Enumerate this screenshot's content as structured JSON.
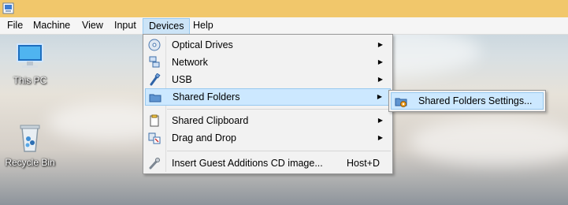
{
  "menubar": {
    "items": [
      {
        "label": "File"
      },
      {
        "label": "Machine"
      },
      {
        "label": "View"
      },
      {
        "label": "Input"
      },
      {
        "label": "Devices"
      },
      {
        "label": "Help"
      }
    ]
  },
  "desktop": {
    "icons": [
      {
        "label": "This PC",
        "icon": "computer-icon"
      },
      {
        "label": "Recycle Bin",
        "icon": "recycle-bin-icon"
      }
    ]
  },
  "devices_menu": {
    "items": [
      {
        "label": "Optical Drives",
        "icon": "optical-disc-icon",
        "submenu": true
      },
      {
        "label": "Network",
        "icon": "network-icon",
        "submenu": true
      },
      {
        "label": "USB",
        "icon": "usb-icon",
        "submenu": true
      },
      {
        "label": "Shared Folders",
        "icon": "folder-icon",
        "submenu": true,
        "highlighted": true
      },
      {
        "label": "Shared Clipboard",
        "icon": "clipboard-icon",
        "submenu": true
      },
      {
        "label": "Drag and Drop",
        "icon": "drag-drop-icon",
        "submenu": true
      },
      {
        "label": "Insert Guest Additions CD image...",
        "icon": "guest-additions-icon",
        "shortcut": "Host+D"
      }
    ]
  },
  "shared_folders_submenu": {
    "items": [
      {
        "label": "Shared Folders Settings...",
        "icon": "folder-settings-icon",
        "highlighted": true
      }
    ]
  },
  "colors": {
    "titlebar": "#f1c76b",
    "menubar": "#f5f5f5",
    "highlight": "#cce8ff",
    "highlight_border": "#99c9ef"
  }
}
